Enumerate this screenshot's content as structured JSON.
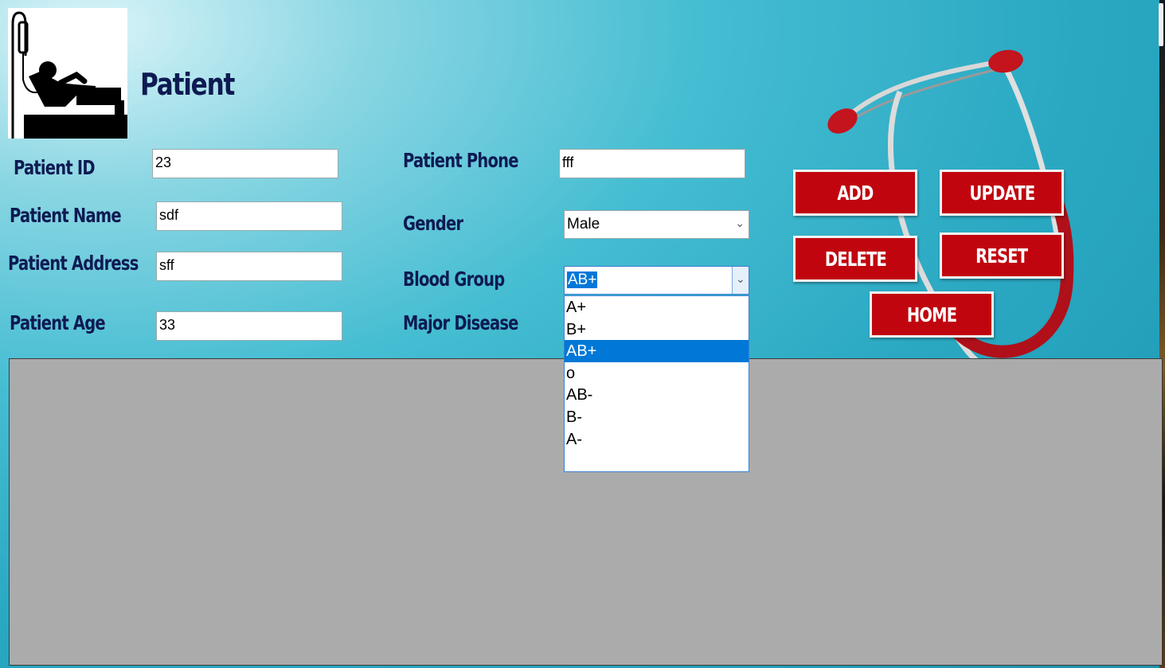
{
  "header": {
    "title": "Patient",
    "logo_icon": "patient-bed-icon"
  },
  "form": {
    "patient_id": {
      "label": "Patient ID",
      "value": "23"
    },
    "patient_name": {
      "label": "Patient Name",
      "value": "sdf"
    },
    "patient_address": {
      "label": "Patient Address",
      "value": "sff"
    },
    "patient_age": {
      "label": "Patient Age",
      "value": "33"
    },
    "patient_phone": {
      "label": "Patient Phone",
      "value": "fff"
    },
    "gender": {
      "label": "Gender",
      "value": "Male"
    },
    "blood_group": {
      "label": "Blood Group",
      "value": "AB+",
      "options": [
        "A+",
        "B+",
        "AB+",
        "o",
        "AB-",
        "B-",
        "A-"
      ],
      "selected_index": 2
    },
    "major_disease": {
      "label": "Major Disease"
    }
  },
  "buttons": {
    "add": "ADD",
    "update": "UPDATE",
    "delete": "DELETE",
    "reset": "RESET",
    "home": "HOME"
  },
  "colors": {
    "button_red": "#c0050f",
    "label_navy": "#0e1a52",
    "selection_blue": "#0078d7",
    "grid_gray": "#ababab"
  }
}
